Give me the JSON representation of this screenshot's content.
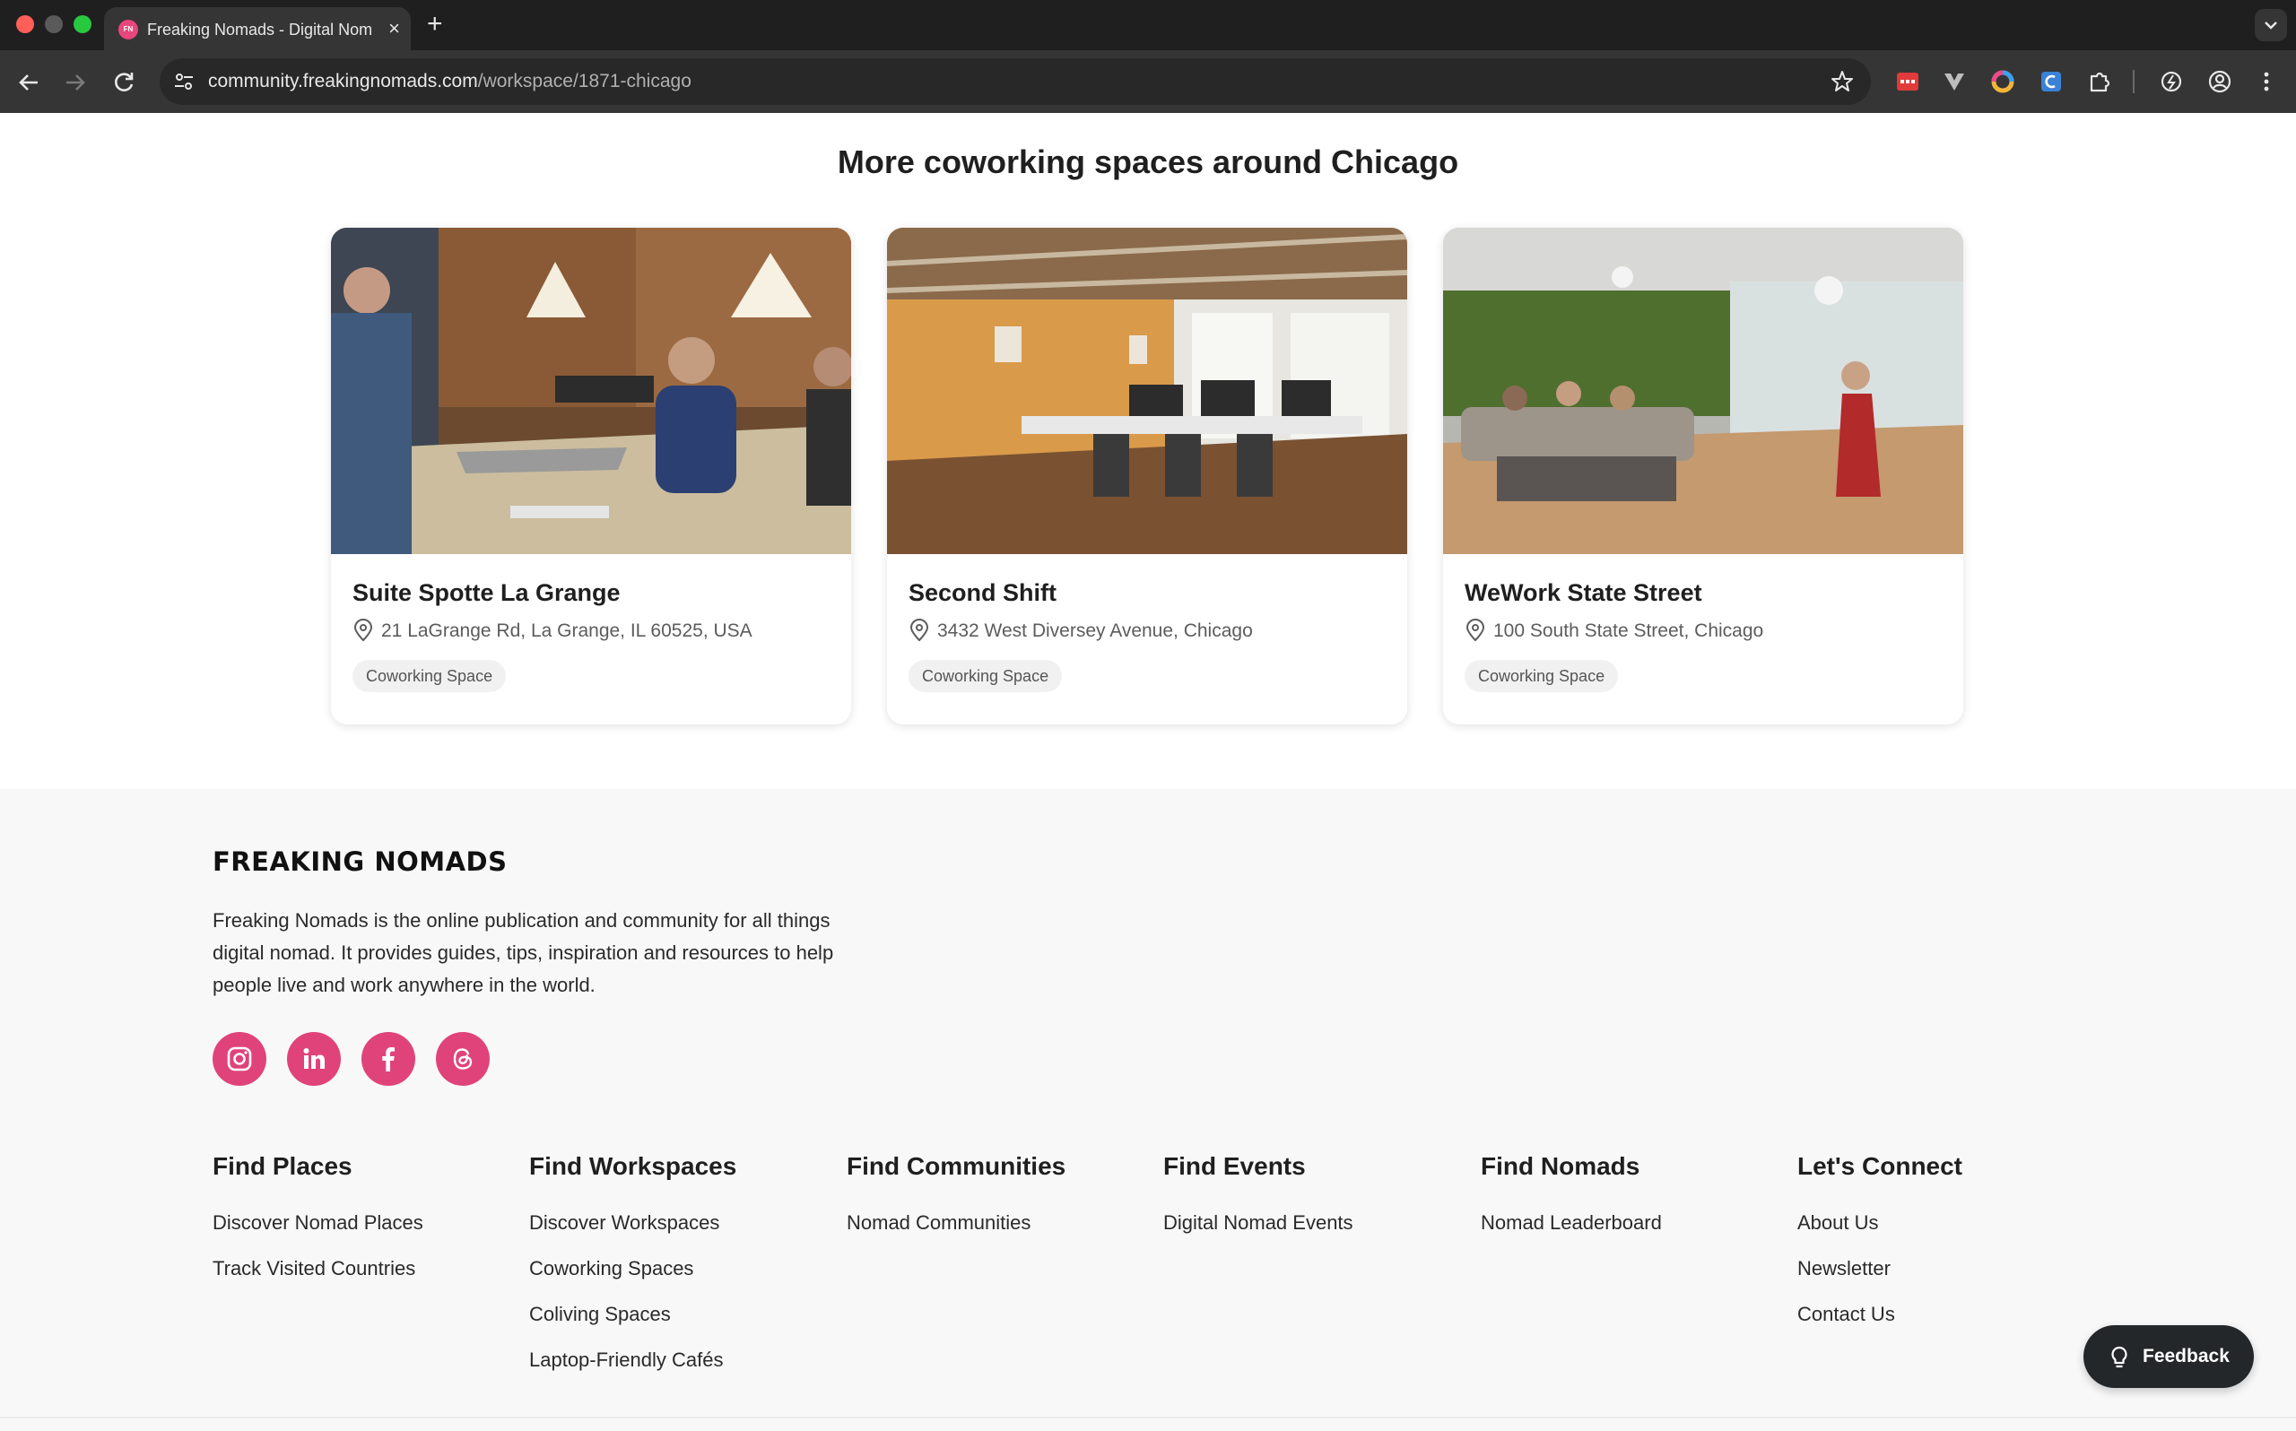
{
  "browser": {
    "tab_title": "Freaking Nomads - Digital Nomad",
    "favicon_text": "FN",
    "url_host": "community.freakingnomads.com",
    "url_path": "/workspace/1871-chicago"
  },
  "section": {
    "title": "More coworking spaces around Chicago"
  },
  "cards": [
    {
      "name": "Suite Spotte La Grange",
      "address": "21 LaGrange Rd, La Grange, IL 60525, USA",
      "tag": "Coworking Space"
    },
    {
      "name": "Second Shift",
      "address": "3432 West Diversey Avenue, Chicago",
      "tag": "Coworking Space"
    },
    {
      "name": "WeWork State Street",
      "address": "100 South State Street, Chicago",
      "tag": "Coworking Space"
    }
  ],
  "footer": {
    "brand": "FREAKING NOMADS",
    "about": "Freaking Nomads is the online publication and community for all things digital nomad. It provides guides, tips, inspiration and resources to help people live and work anywhere in the world.",
    "social_icons": [
      "instagram-icon",
      "linkedin-icon",
      "facebook-icon",
      "threads-icon"
    ],
    "columns": [
      {
        "heading": "Find Places",
        "links": [
          "Discover Nomad Places",
          "Track Visited Countries"
        ]
      },
      {
        "heading": "Find Workspaces",
        "links": [
          "Discover Workspaces",
          "Coworking Spaces",
          "Coliving Spaces",
          "Laptop-Friendly Cafés"
        ]
      },
      {
        "heading": "Find Communities",
        "links": [
          "Nomad Communities"
        ]
      },
      {
        "heading": "Find Events",
        "links": [
          "Digital Nomad Events"
        ]
      },
      {
        "heading": "Find Nomads",
        "links": [
          "Nomad Leaderboard"
        ]
      },
      {
        "heading": "Let's Connect",
        "links": [
          "About Us",
          "Newsletter",
          "Contact Us"
        ]
      }
    ]
  },
  "feedback": {
    "label": "Feedback"
  },
  "colors": {
    "accent": "#e0437a",
    "footer_bg": "#f8f8f8",
    "feedback_bg": "#23272a"
  }
}
